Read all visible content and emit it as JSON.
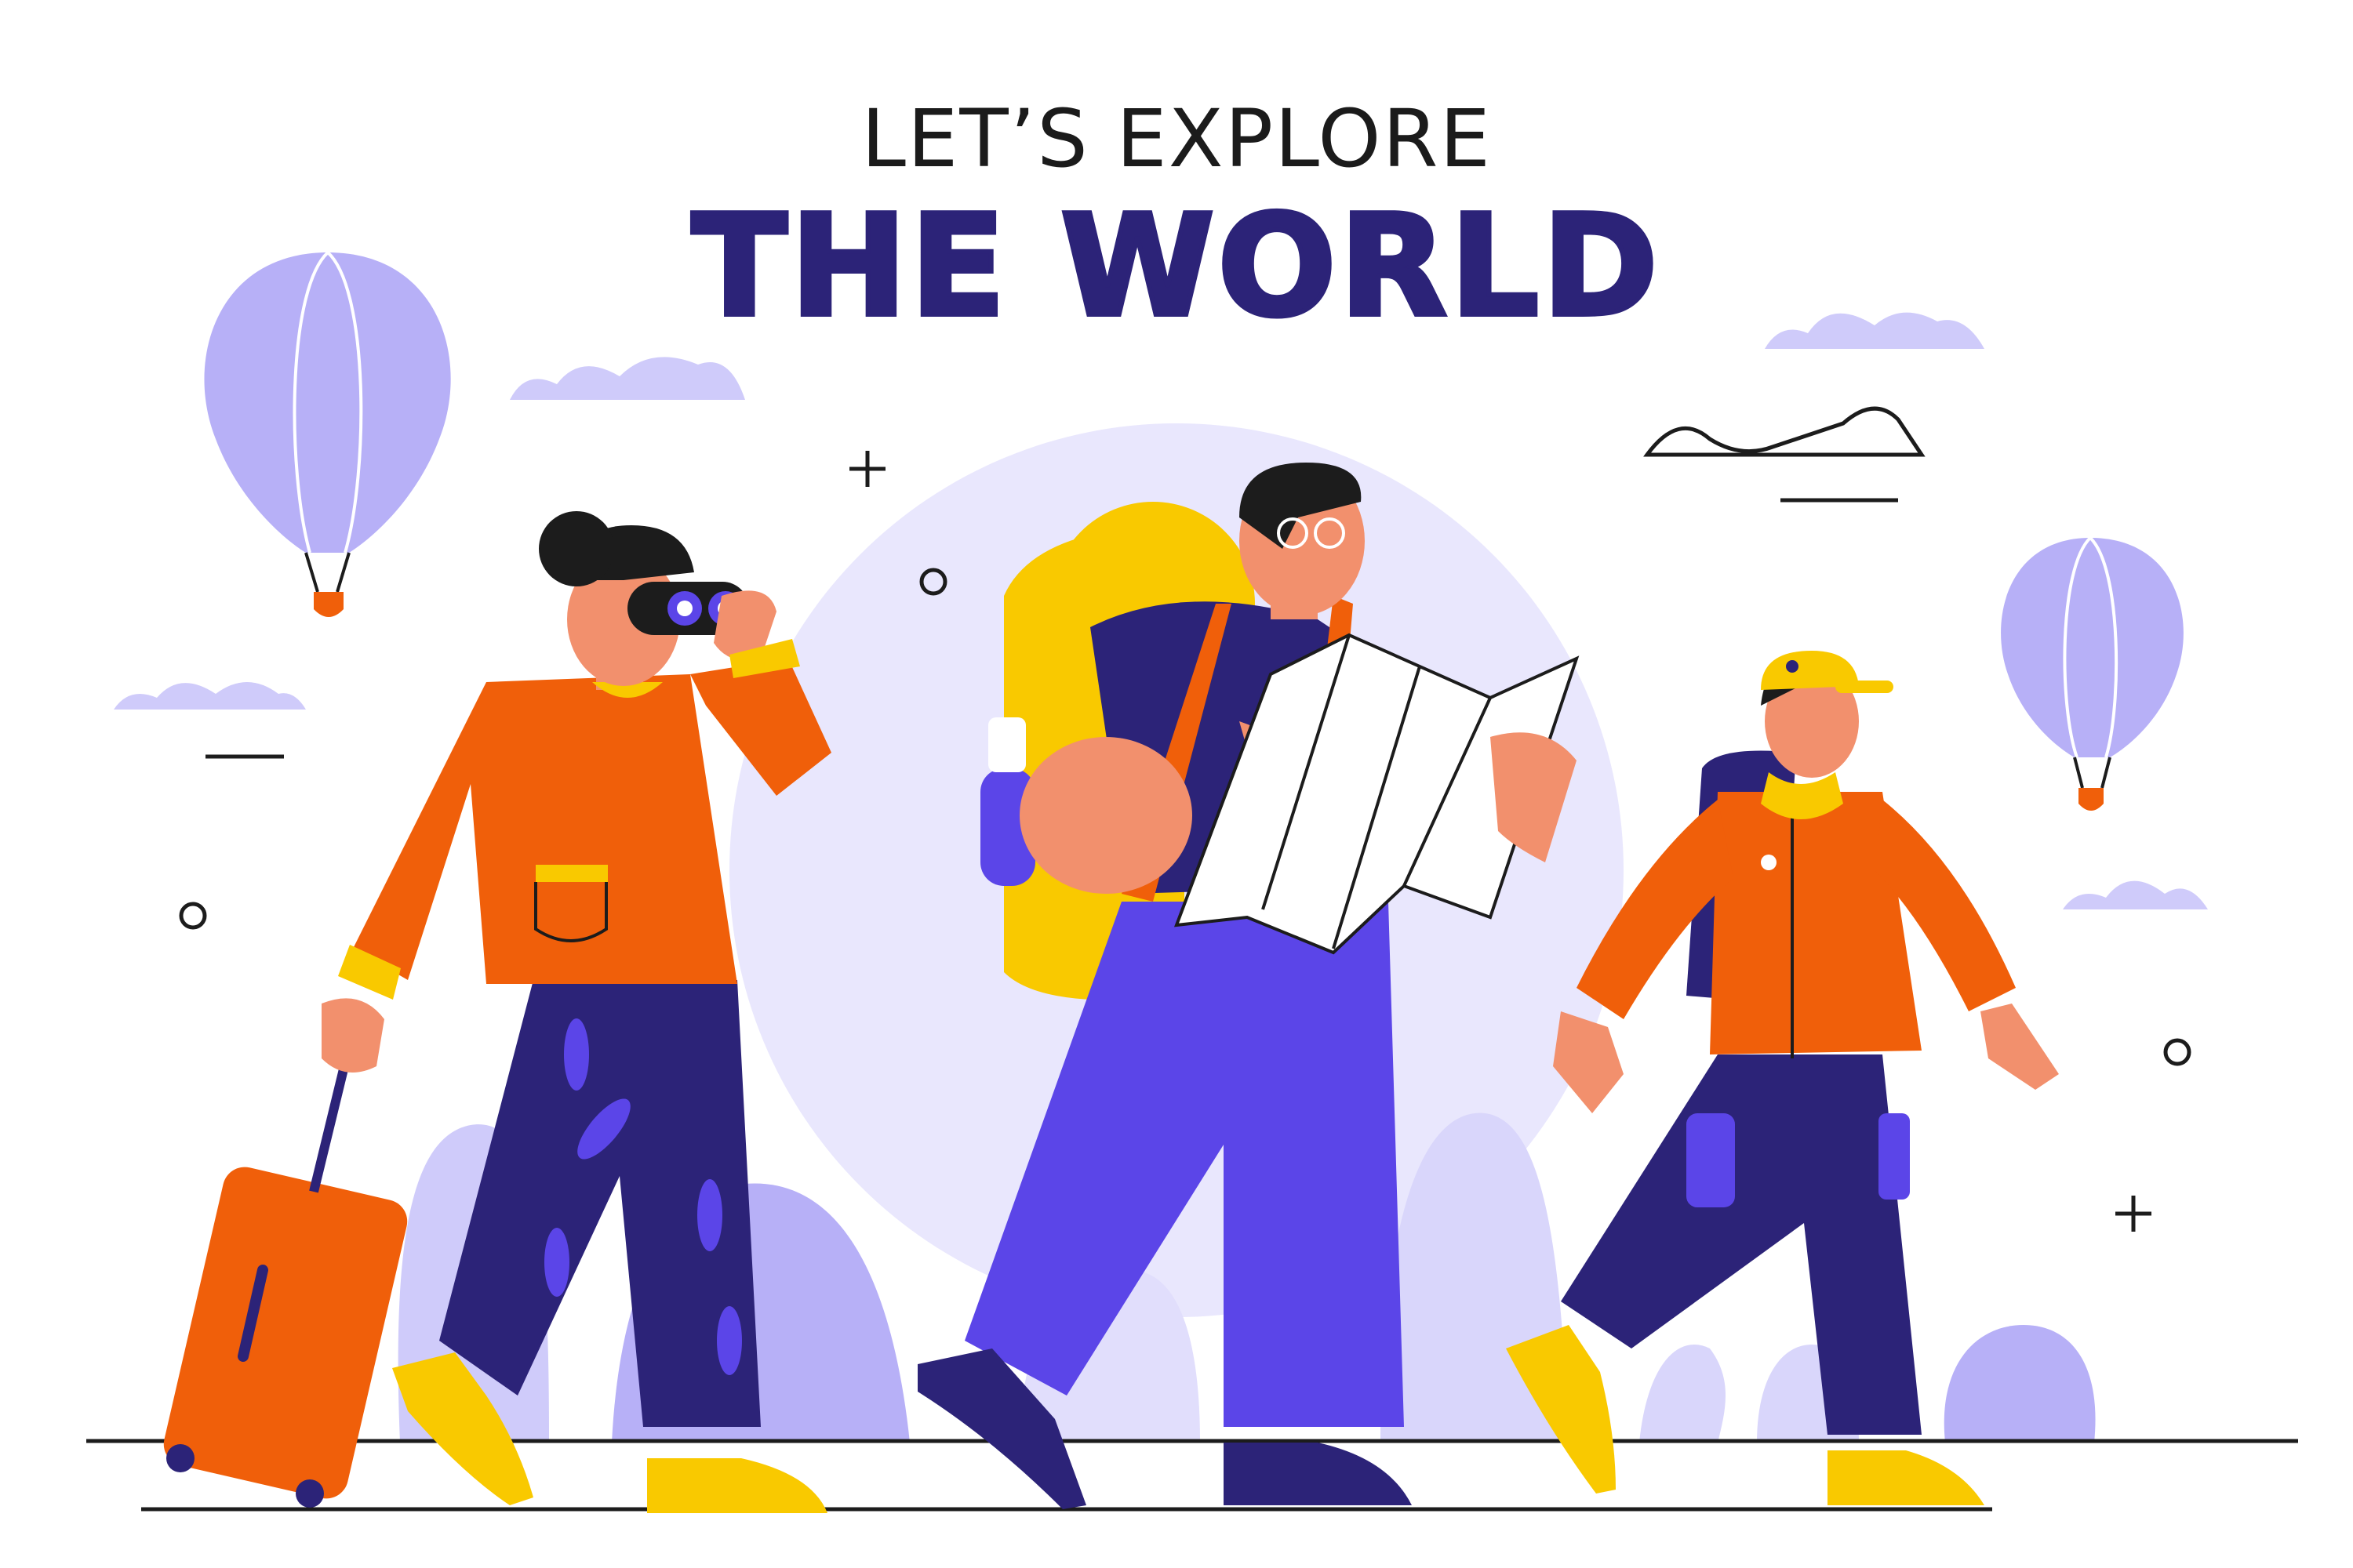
{
  "heading": {
    "subtitle": "LET’S EXPLORE",
    "title": "THE WORLD"
  },
  "colors": {
    "navy": "#2c2378",
    "violet": "#5b45e8",
    "lavender": "#b7b0f7",
    "pale_lavender": "#e9e7fd",
    "orange": "#f05f0a",
    "yellow": "#f9c900",
    "skin": "#f2906d",
    "dark_hair": "#1c1c1c"
  },
  "figures": [
    {
      "name": "woman-with-binoculars",
      "props": [
        "binoculars",
        "suitcase"
      ]
    },
    {
      "name": "man-with-map",
      "props": [
        "map",
        "backpack",
        "water-bottle"
      ]
    },
    {
      "name": "boy-with-cap",
      "props": [
        "cap",
        "backpack"
      ]
    }
  ],
  "decorations": [
    "hot-air-balloon-left",
    "hot-air-balloon-right",
    "clouds",
    "sun-circle",
    "plants"
  ]
}
